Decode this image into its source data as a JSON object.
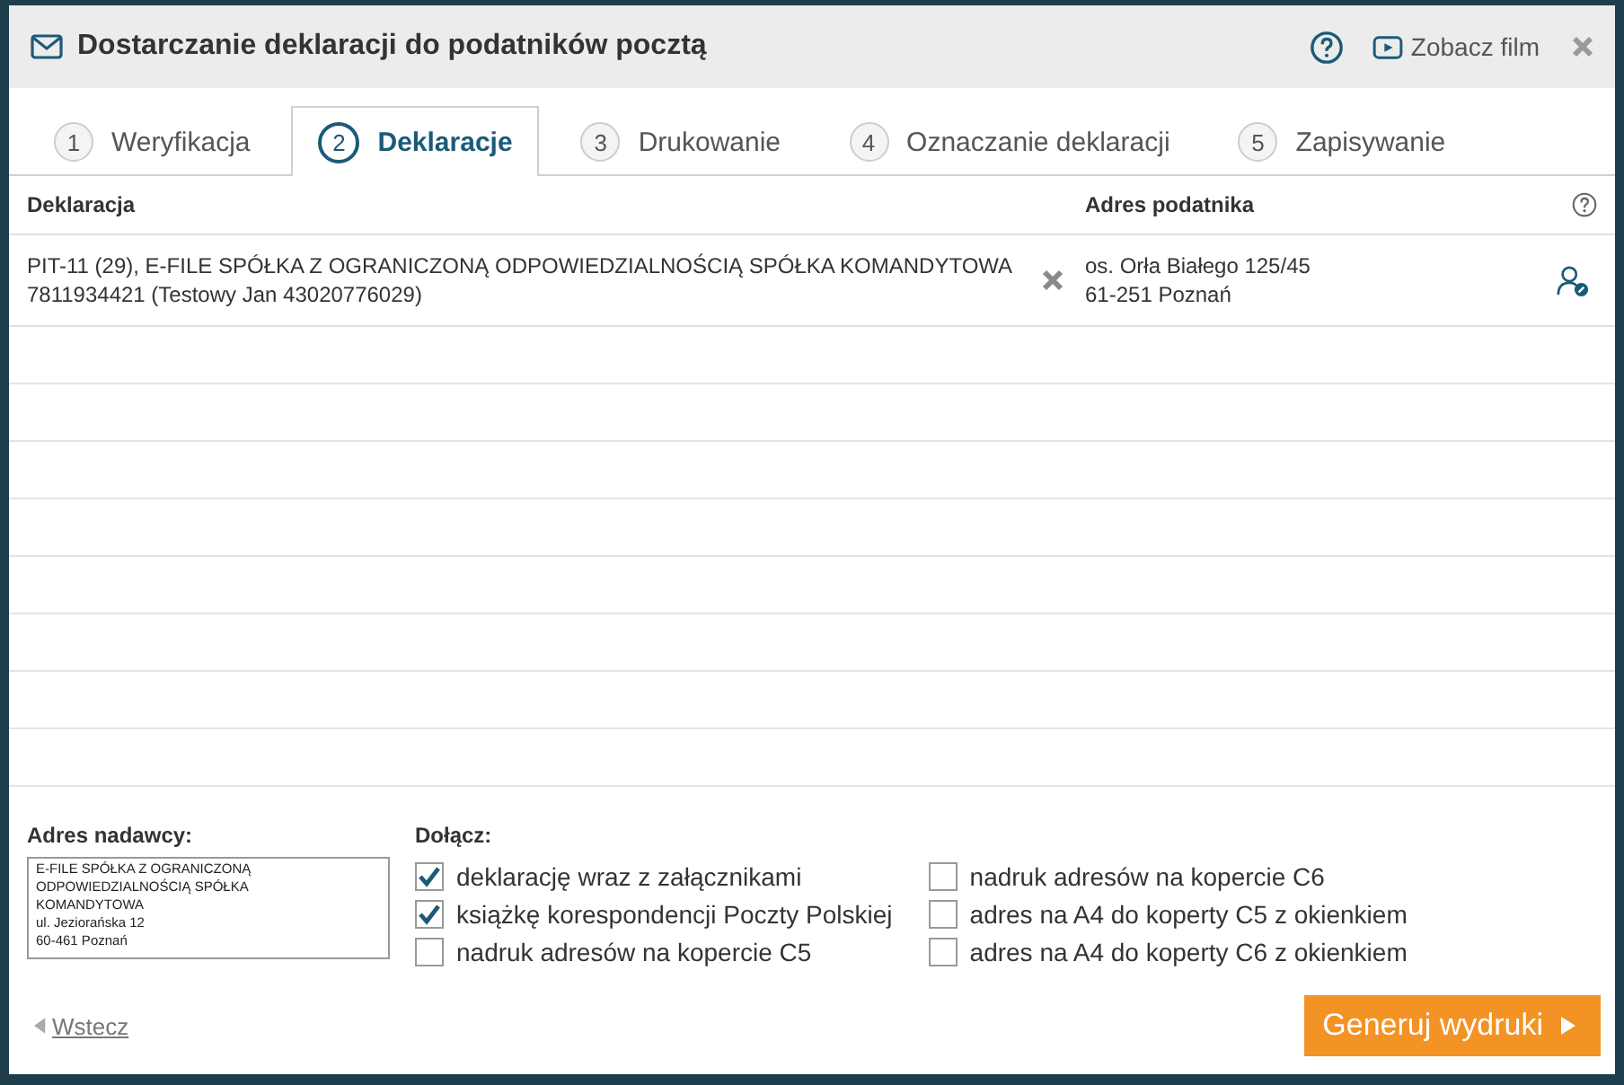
{
  "window": {
    "title": "Dostarczanie deklaracji do podatników pocztą",
    "video_link": "Zobacz film"
  },
  "tabs": [
    {
      "number": "1",
      "label": "Weryfikacja",
      "selected": false
    },
    {
      "number": "2",
      "label": "Deklaracje",
      "selected": true
    },
    {
      "number": "3",
      "label": "Drukowanie",
      "selected": false
    },
    {
      "number": "4",
      "label": "Oznaczanie deklaracji",
      "selected": false
    },
    {
      "number": "5",
      "label": "Zapisywanie",
      "selected": false
    }
  ],
  "table": {
    "columns": [
      "Deklaracja",
      "Adres podatnika"
    ],
    "rows": [
      {
        "declaration": [
          "PIT-11 (29), E-FILE SPÓŁKA Z OGRANICZONĄ ODPOWIEDZIALNOŚCIĄ SPÓŁKA KOMANDYTOWA",
          "7811934421 (Testowy Jan 43020776029)"
        ],
        "address": [
          "os. Orła Białego 125/45",
          "61-251 Poznań"
        ]
      }
    ]
  },
  "sender": {
    "label": "Adres nadawcy:",
    "value": "E-FILE SPÓŁKA Z OGRANICZONĄ\nODPOWIEDZIALNOŚCIĄ SPÓŁKA\nKOMANDYTOWA\nul. Jeziorańska 12\n60-461 Poznań"
  },
  "attach": {
    "label": "Dołącz:",
    "options": [
      {
        "label": "deklarację wraz z załącznikami",
        "checked": true
      },
      {
        "label": "książkę korespondencji Poczty Polskiej",
        "checked": true
      },
      {
        "label": "nadruk adresów na kopercie C5",
        "checked": false
      },
      {
        "label": "nadruk adresów na kopercie C6",
        "checked": false
      },
      {
        "label": "adres na A4 do koperty C5 z okienkiem",
        "checked": false
      },
      {
        "label": "adres na A4 do koperty C6 z okienkiem",
        "checked": false
      }
    ]
  },
  "back_link": "Wstecz",
  "primary_button": "Generuj wydruki"
}
